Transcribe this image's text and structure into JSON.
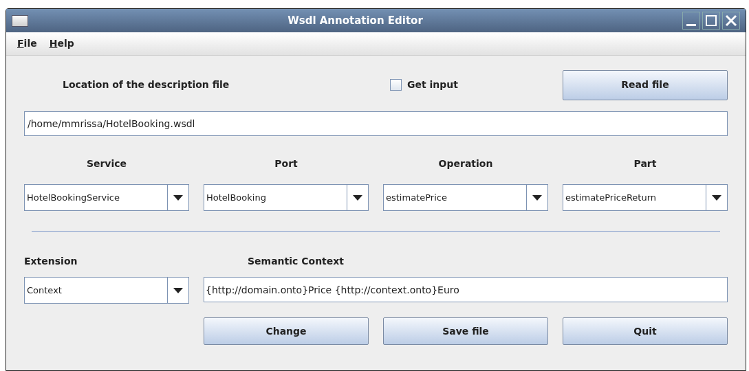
{
  "window": {
    "title": "Wsdl Annotation Editor"
  },
  "menu": [
    "File",
    "Help"
  ],
  "location_label": "Location of the description file",
  "get_input": {
    "label": "Get input",
    "checked": false
  },
  "read_button": "Read file",
  "path_field": {
    "value": "/home/mmrissa/HotelBooking.wsdl"
  },
  "selectors": [
    {
      "label": "Service",
      "value": "HotelBookingService"
    },
    {
      "label": "Port",
      "value": "HotelBooking"
    },
    {
      "label": "Operation",
      "value": "estimatePrice"
    },
    {
      "label": "Part",
      "value": "estimatePriceReturn"
    }
  ],
  "extension": {
    "label": "Extension",
    "value": "Context"
  },
  "semantic_context": {
    "label": "Semantic Context",
    "value": "{http://domain.onto}Price {http://context.onto}Euro"
  },
  "buttons": [
    "Change",
    "Save file",
    "Quit"
  ]
}
